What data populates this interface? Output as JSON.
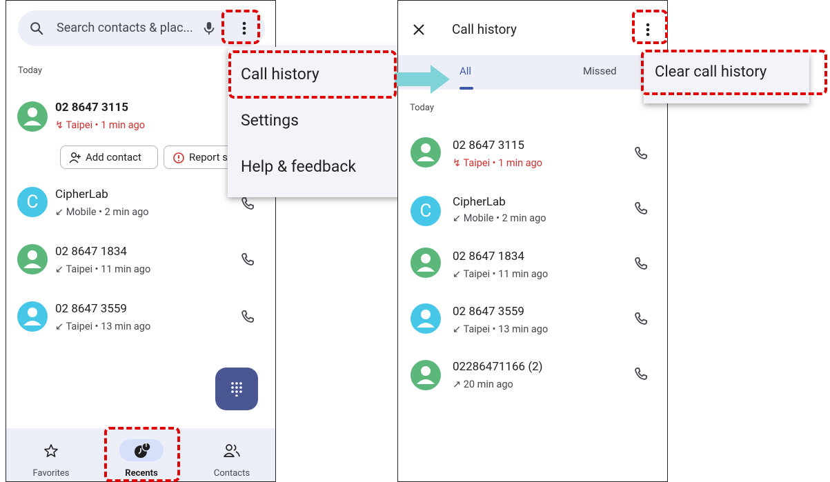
{
  "left": {
    "search": {
      "placeholder": "Search contacts & plac..."
    },
    "section_today": "Today",
    "rows": [
      {
        "name": "02 8647 3115",
        "sub": "Taipei • 1 min ago"
      },
      {
        "name": "CipherLab",
        "sub": "Mobile • 2 min ago",
        "avatar_letter": "C"
      },
      {
        "name": "02 8647 1834",
        "sub": "Taipei • 11 min ago"
      },
      {
        "name": "02 8647 3559",
        "sub": "Taipei • 13 min ago"
      }
    ],
    "chips": {
      "add_contact": "Add contact",
      "report": "Report s"
    },
    "menu": [
      "Call history",
      "Settings",
      "Help & feedback"
    ],
    "nav": {
      "favorites": "Favorites",
      "recents": "Recents",
      "contacts": "Contacts",
      "recents_badge": "1"
    }
  },
  "right": {
    "title": "Call history",
    "tabs": {
      "all": "All",
      "missed": "Missed"
    },
    "section_today": "Today",
    "rows": [
      {
        "name": "02 8647 3115",
        "sub": "Taipei • 1 min ago"
      },
      {
        "name": "CipherLab",
        "sub": "Mobile • 2 min ago",
        "avatar_letter": "C"
      },
      {
        "name": "02 8647 1834",
        "sub": "Taipei • 11 min ago"
      },
      {
        "name": "02 8647 3559",
        "sub": "Taipei • 13 min ago"
      },
      {
        "name": "02286471166 (2)",
        "sub": "20 min ago"
      }
    ],
    "menu": {
      "clear": "Clear call history"
    }
  },
  "colors": {
    "missed": "#d32f2f",
    "accent": "#3d5aa8",
    "highlight": "#e00000",
    "arrow": "#7fd3d8"
  }
}
